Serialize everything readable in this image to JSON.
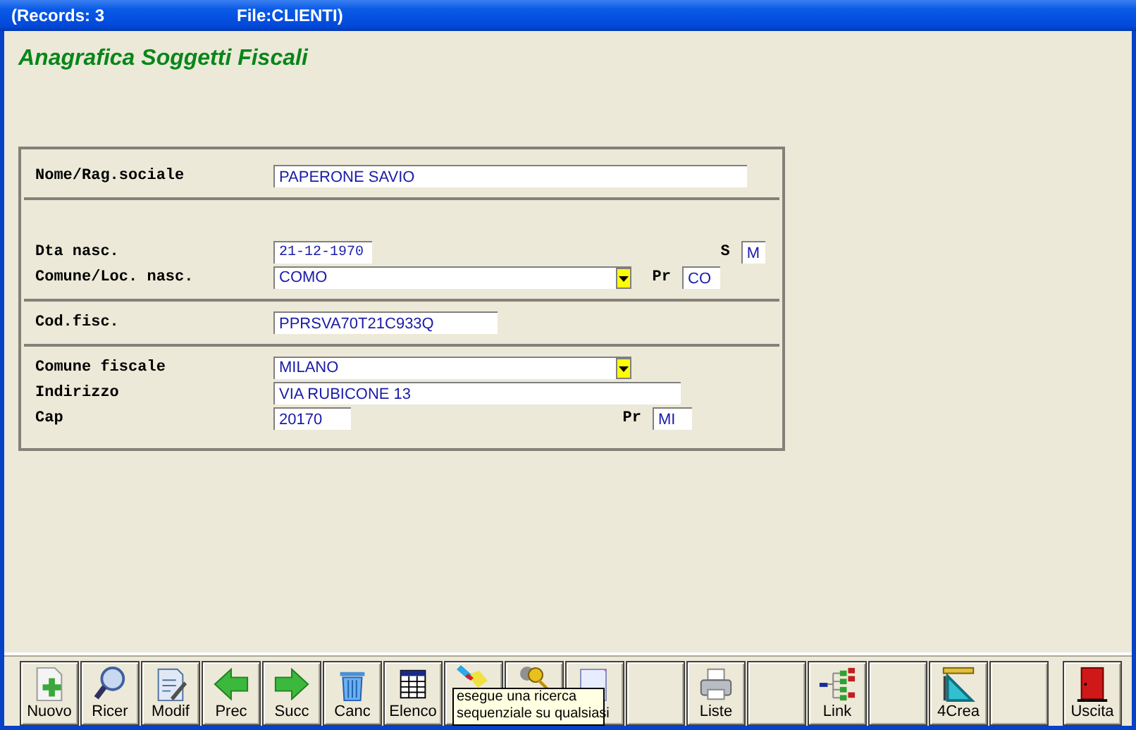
{
  "title_bar": {
    "records": "(Records: 3",
    "file": "File:CLIENTI)"
  },
  "heading": "Anagrafica Soggetti Fiscali",
  "form": {
    "sections": [
      {
        "rows": [
          {
            "label": "Nome/Rag.sociale",
            "field": {
              "kind": "text",
              "value": "PAPERONE SAVIO"
            }
          }
        ]
      },
      {
        "rows": [
          {
            "label": "Dta nasc.",
            "field": {
              "kind": "date",
              "value": "21-12-1970"
            },
            "side": {
              "label": "S",
              "value": "M"
            }
          },
          {
            "label": "Comune/Loc. nasc.",
            "field": {
              "kind": "combo",
              "value": "COMO"
            },
            "side": {
              "label": "Pr",
              "value": "CO"
            }
          }
        ]
      },
      {
        "rows": [
          {
            "label": "Cod.fisc.",
            "field": {
              "kind": "text",
              "value": "PPRSVA70T21C933Q"
            }
          }
        ]
      },
      {
        "rows": [
          {
            "label": "Comune fiscale",
            "field": {
              "kind": "combo",
              "value": "MILANO"
            }
          },
          {
            "label": "Indirizzo",
            "field": {
              "kind": "text",
              "value": "VIA RUBICONE 13"
            }
          },
          {
            "label": "Cap",
            "field": {
              "kind": "text",
              "value": "20170"
            },
            "side": {
              "label": "Pr",
              "value": "MI"
            }
          }
        ]
      }
    ]
  },
  "toolbar": [
    {
      "kind": "new",
      "label": "Nuovo"
    },
    {
      "kind": "search",
      "label": "Ricer"
    },
    {
      "kind": "edit",
      "label": "Modif"
    },
    {
      "kind": "prev",
      "label": "Prec"
    },
    {
      "kind": "next",
      "label": "Succ"
    },
    {
      "kind": "trash",
      "label": "Canc"
    },
    {
      "kind": "table",
      "label": "Elenco"
    },
    {
      "kind": "flashlight"
    },
    {
      "kind": "keys"
    },
    {
      "kind": "document"
    },
    {
      "kind": "empty"
    },
    {
      "kind": "printer",
      "label": "Liste"
    },
    {
      "kind": "empty"
    },
    {
      "kind": "tree",
      "label": "Link"
    },
    {
      "kind": "empty"
    },
    {
      "kind": "setsquare",
      "label": "4Crea"
    },
    {
      "kind": "empty"
    },
    {
      "kind": "door",
      "label": "Uscita"
    }
  ],
  "tooltip": [
    "esegue una ricerca",
    "sequenziale su qualsiasi"
  ]
}
